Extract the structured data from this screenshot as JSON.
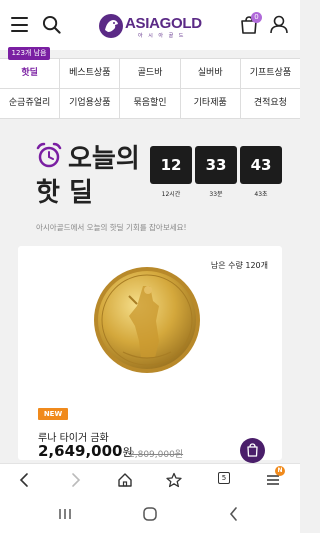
{
  "header": {
    "logo_text": "ASIAGOLD",
    "logo_sub": "아 시 아 골 드",
    "cart_count": "0",
    "icons": [
      "hamburger-icon",
      "search-icon",
      "cart-icon",
      "user-icon"
    ]
  },
  "hot_tag": "123개 남음",
  "categories": {
    "row1": [
      "핫딜",
      "베스트상품",
      "골드바",
      "실버바",
      "기프트상품"
    ],
    "row2": [
      "순금쥬얼리",
      "기업용상품",
      "묶음할인",
      "기타제품",
      "견적요청"
    ],
    "active": "핫딜"
  },
  "hero": {
    "title_line1": "오늘의",
    "title_line2": "핫 딜",
    "subtitle": "아시아골드에서 오늘의 핫딜 기회를 잡아보세요!",
    "timer": [
      {
        "value": "12",
        "label": "12시간"
      },
      {
        "value": "33",
        "label": "33분"
      },
      {
        "value": "43",
        "label": "43초"
      }
    ]
  },
  "product": {
    "stock": "남은 수량 120개",
    "badge": "NEW",
    "name": "루나 타이거 금화",
    "price": "2,649,000",
    "price_unit": "원",
    "old_price": "2,809,000원"
  },
  "colors": {
    "brand": "#7a1fa2",
    "badge_orange": "#f08a1c",
    "timer_bg": "#1c1c1c",
    "fab": "#4a1e6a"
  },
  "browser": {
    "tab_count": "5",
    "menu_badge": "N"
  }
}
